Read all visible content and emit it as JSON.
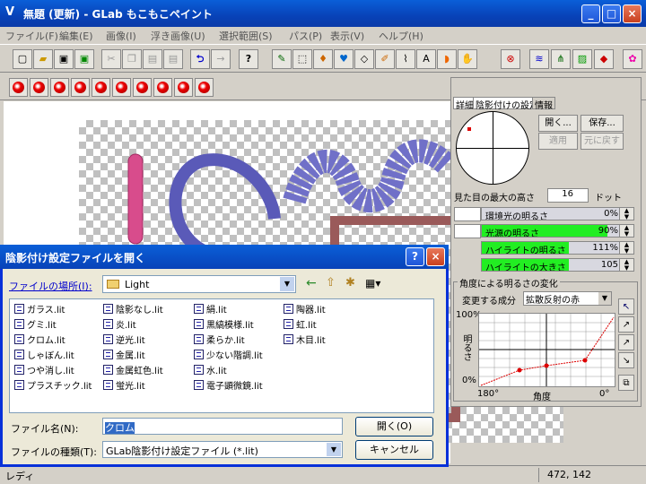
{
  "window": {
    "title": "無題 (更新) - GLab もこもこペイント",
    "minimize": "_",
    "maximize": "□",
    "close": "×"
  },
  "menu": [
    "ファイル(F)",
    "編集(E)",
    "画像(I)",
    "浮き画像(U)",
    "選択範囲(S)",
    "パス(P)",
    "表示(V)",
    "ヘルプ(H)"
  ],
  "toolbar_icons": [
    "new-icon",
    "open-icon",
    "save-icon",
    "save-as-icon",
    "cut-icon",
    "copy-icon",
    "paste-icon",
    "paste-new-icon",
    "undo-icon",
    "redo-icon",
    "help-icon",
    "brush-icon",
    "select-icon",
    "fill-icon",
    "drop-icon",
    "eraser-icon",
    "pen-icon",
    "lasso-icon",
    "text-icon",
    "rainbow-icon",
    "hand-icon",
    "effect-icon",
    "wave-icon",
    "grass-icon",
    "stripe-icon",
    "cube-icon",
    "color-wheel-icon"
  ],
  "toolbar_glyphs": {
    "help": "?",
    "undo": "⮌",
    "redo": "→",
    "select": "⬚",
    "text": "A"
  },
  "status": {
    "text": "レディ",
    "coords": "472, 142"
  },
  "panel": {
    "tabs": [
      "詳細",
      "陰影付けの設定",
      "情報"
    ],
    "open_button": "開く...",
    "save_button": "保存...",
    "apply_button": "適用",
    "revert_button": "元に戻す",
    "max_height_label": "見た目の最大の高さ",
    "max_height_value": "16",
    "max_height_unit": "ドット",
    "rows": [
      {
        "label": "環境光の明るさ",
        "value": "0%",
        "fill_color": "",
        "fill_fraction": 0
      },
      {
        "label": "光源の明るさ",
        "value": "90%",
        "fill_color": "#22ee22",
        "fill_fraction": 0.9
      },
      {
        "label": "ハイライトの明るさ",
        "value": "111%",
        "fill_color": "#22ee22",
        "fill_fraction": 0.62
      },
      {
        "label": "ハイライトの大きさ",
        "value": "105",
        "fill_color": "#22ee22",
        "fill_fraction": 0.62
      }
    ],
    "curve_group": "角度による明るさの変化",
    "component_label": "変更する成分",
    "component_value": "拡散反射の赤",
    "y_top": "100%",
    "y_bottom": "0%",
    "y_label": "明るさ",
    "x_left": "180°",
    "x_mid": "角度",
    "x_right": "0°"
  },
  "dialog": {
    "title": "陰影付け設定ファイルを開く",
    "help": "?",
    "close": "×",
    "location_label": "ファイルの場所(I):",
    "location_value": "Light",
    "files": [
      [
        "ガラス.lit",
        "グミ.lit",
        "クロム.lit",
        "しゃぼん.lit",
        "つや消し.lit",
        "プラスチック.lit"
      ],
      [
        "陰影なし.lit",
        "炎.lit",
        "逆光.lit",
        "金属.lit",
        "金属虹色.lit",
        "蛍光.lit"
      ],
      [
        "絹.lit",
        "黒縞模様.lit",
        "柔らか.lit",
        "少ない階調.lit",
        "水.lit",
        "電子顕微鏡.lit"
      ],
      [
        "陶器.lit",
        "虹.lit",
        "木目.lit"
      ]
    ],
    "filename_label": "ファイル名(N):",
    "filename_value": "クロム",
    "filetype_label": "ファイルの種類(T):",
    "filetype_value": "GLab陰影付け設定ファイル (*.lit)",
    "open_button": "開く(O)",
    "cancel_button": "キャンセル"
  }
}
